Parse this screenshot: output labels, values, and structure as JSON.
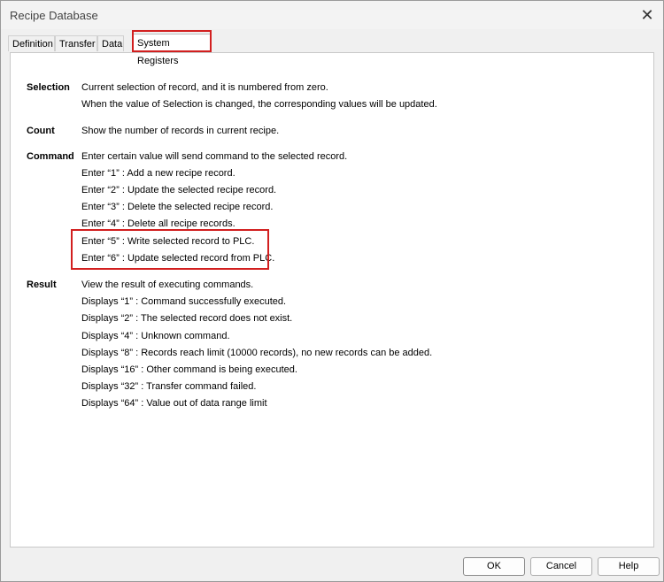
{
  "window": {
    "title": "Recipe Database",
    "close_glyph": "✕"
  },
  "tabs": [
    {
      "label": "Definition"
    },
    {
      "label": "Transfer"
    },
    {
      "label": "Data"
    },
    {
      "label": "System Registers"
    }
  ],
  "registers": {
    "selection": {
      "term": "Selection",
      "lines": [
        "Current selection of record, and it is numbered from zero.",
        "When the value of Selection is changed, the corresponding values will be updated."
      ]
    },
    "count": {
      "term": "Count",
      "lines": [
        "Show the number of records in current recipe."
      ]
    },
    "command": {
      "term": "Command",
      "lines": [
        "Enter certain value will send command to the selected record.",
        "Enter “1” : Add a new recipe record.",
        "Enter “2” : Update the selected recipe record.",
        "Enter “3” : Delete the selected recipe record.",
        "Enter “4” : Delete all recipe records.",
        "Enter “5” : Write selected record to PLC.",
        "Enter “6” : Update selected record from PLC."
      ]
    },
    "result": {
      "term": "Result",
      "lines": [
        "View the result of executing commands.",
        "Displays “1” : Command successfully executed.",
        "Displays “2” : The selected record does not exist.",
        "Displays “4” : Unknown command.",
        "Displays “8” : Records reach limit (10000 records), no new records can be added.",
        "Displays “16” : Other command is being executed.",
        "Displays “32” : Transfer command  failed.",
        "Displays “64” : Value out of data range limit"
      ]
    }
  },
  "buttons": {
    "ok": "OK",
    "cancel": "Cancel",
    "help": "Help"
  },
  "colors": {
    "highlight": "#d21f1f"
  }
}
